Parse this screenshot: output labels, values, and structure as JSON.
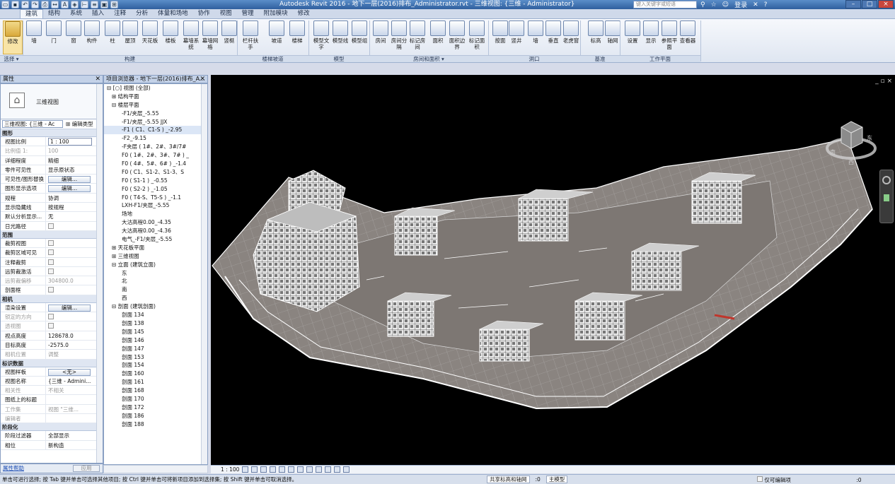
{
  "window": {
    "title": "Autodesk Revit 2016 -   地下一层(2016)排布_Administrator.rvt - 三维视图: {三维 - Administrator}",
    "search_placeholder": "键入关键字或短语",
    "login": "登录"
  },
  "app_button": "R",
  "ribbon_tabs": [
    "建筑",
    "结构",
    "系统",
    "插入",
    "注释",
    "分析",
    "体量和场地",
    "协作",
    "视图",
    "管理",
    "附加模块",
    "修改"
  ],
  "ribbon": {
    "tools": [
      {
        "label": "修改",
        "name": "modify-tool"
      },
      {
        "label": "墙",
        "name": "wall-tool"
      },
      {
        "label": "门",
        "name": "door-tool"
      },
      {
        "label": "窗",
        "name": "window-tool"
      },
      {
        "label": "构件",
        "name": "component-tool"
      },
      {
        "label": "柱",
        "name": "column-tool"
      },
      {
        "label": "屋顶",
        "name": "roof-tool"
      },
      {
        "label": "天花板",
        "name": "ceiling-tool"
      },
      {
        "label": "楼板",
        "name": "floor-tool"
      },
      {
        "label": "幕墙系统",
        "name": "curtain-system-tool"
      },
      {
        "label": "幕墙网格",
        "name": "curtain-grid-tool"
      },
      {
        "label": "竖梃",
        "name": "mullion-tool"
      },
      {
        "label": "栏杆扶手",
        "name": "railing-tool"
      },
      {
        "label": "坡道",
        "name": "ramp-tool"
      },
      {
        "label": "楼梯",
        "name": "stair-tool"
      },
      {
        "label": "模型文字",
        "name": "model-text-tool"
      },
      {
        "label": "模型线",
        "name": "model-line-tool"
      },
      {
        "label": "模型组",
        "name": "model-group-tool"
      },
      {
        "label": "房间",
        "name": "room-tool"
      },
      {
        "label": "房间分隔",
        "name": "room-separator-tool"
      },
      {
        "label": "标记房间",
        "name": "tag-room-tool"
      },
      {
        "label": "面积",
        "name": "area-tool"
      },
      {
        "label": "面积边界",
        "name": "area-boundary-tool"
      },
      {
        "label": "标记面积",
        "name": "tag-area-tool"
      },
      {
        "label": "按面",
        "name": "by-face-tool"
      },
      {
        "label": "竖井",
        "name": "shaft-tool"
      },
      {
        "label": "墙",
        "name": "wall-opening-tool"
      },
      {
        "label": "垂直",
        "name": "vertical-opening-tool"
      },
      {
        "label": "老虎窗",
        "name": "dormer-tool"
      },
      {
        "label": "标高",
        "name": "level-tool"
      },
      {
        "label": "轴网",
        "name": "grid-tool"
      },
      {
        "label": "设置",
        "name": "set-workplane-tool"
      },
      {
        "label": "显示",
        "name": "show-workplane-tool"
      },
      {
        "label": "参照平面",
        "name": "ref-plane-tool"
      },
      {
        "label": "查看器",
        "name": "viewer-tool"
      }
    ],
    "groups": [
      "选择 ▾",
      "构建",
      "楼梯坡道",
      "模型",
      "房间和面积 ▾",
      "洞口",
      "基准",
      "工作平面"
    ]
  },
  "properties": {
    "header": "属性",
    "type_name": "三维视图",
    "type_selector": "三维视图: {三维 - Ac",
    "edit_type": "编辑类型",
    "sections": [
      {
        "title": "图形",
        "rows": [
          {
            "k": "视图比例",
            "v": "1 : 100",
            "kind": "input"
          },
          {
            "k": "比例值 1:",
            "v": "100",
            "kind": "dim"
          },
          {
            "k": "详细程度",
            "v": "精细"
          },
          {
            "k": "零件可见性",
            "v": "显示原状态"
          },
          {
            "k": "可见性/图形替换",
            "v": "编辑...",
            "kind": "button"
          },
          {
            "k": "图形显示选项",
            "v": "编辑...",
            "kind": "button"
          },
          {
            "k": "规程",
            "v": "协调"
          },
          {
            "k": "显示隐藏线",
            "v": "按规程"
          },
          {
            "k": "默认分析显示...",
            "v": "无"
          },
          {
            "k": "日光路径",
            "v": "",
            "kind": "check"
          }
        ]
      },
      {
        "title": "范围",
        "rows": [
          {
            "k": "裁剪视图",
            "v": "",
            "kind": "check"
          },
          {
            "k": "裁剪区域可见",
            "v": "",
            "kind": "check"
          },
          {
            "k": "注释裁剪",
            "v": "",
            "kind": "check"
          },
          {
            "k": "远剪裁激活",
            "v": "",
            "kind": "check"
          },
          {
            "k": "远剪裁偏移",
            "v": "304800.0",
            "kind": "dim"
          },
          {
            "k": "剖面框",
            "v": "",
            "kind": "check"
          }
        ]
      },
      {
        "title": "相机",
        "rows": [
          {
            "k": "渲染设置",
            "v": "编辑...",
            "kind": "button"
          },
          {
            "k": "锁定的方向",
            "v": "",
            "kind": "dimcheck"
          },
          {
            "k": "透视图",
            "v": "",
            "kind": "dimcheck"
          },
          {
            "k": "视点高度",
            "v": "128678.0"
          },
          {
            "k": "目标高度",
            "v": "-2575.0"
          },
          {
            "k": "相机位置",
            "v": "调整",
            "kind": "dim"
          }
        ]
      },
      {
        "title": "标识数据",
        "rows": [
          {
            "k": "视图样板",
            "v": "<无>",
            "kind": "button"
          },
          {
            "k": "视图名称",
            "v": "{三维 - Admini..."
          },
          {
            "k": "相关性",
            "v": "不相关",
            "kind": "dim"
          },
          {
            "k": "图纸上的标题",
            "v": ""
          },
          {
            "k": "工作集",
            "v": "视图 \"三维...",
            "kind": "dim"
          },
          {
            "k": "编辑者",
            "v": "",
            "kind": "dim"
          }
        ]
      },
      {
        "title": "阶段化",
        "rows": [
          {
            "k": "阶段过滤器",
            "v": "全部显示"
          },
          {
            "k": "相位",
            "v": "新构造"
          }
        ]
      }
    ],
    "help_link": "属性帮助",
    "apply": "应用"
  },
  "browser": {
    "header": "项目浏览器 - 地下一层(2016)排布_A...",
    "items": [
      {
        "t": "⊟ [○] 视图 (全部)",
        "d": 0
      },
      {
        "t": "⊞  结构平面",
        "d": 1
      },
      {
        "t": "⊟  楼层平面",
        "d": 1
      },
      {
        "t": "-F1/夹层_-5.55",
        "d": 3
      },
      {
        "t": "-F1/夹层_-5.55 JJX",
        "d": 3
      },
      {
        "t": "-F1 ( C1、C1-S ) _-2.95",
        "d": 3,
        "sel": true
      },
      {
        "t": "-F2_-9.15",
        "d": 3
      },
      {
        "t": "-F夹层 ( 1#、2#、3#/7#",
        "d": 3
      },
      {
        "t": "F0 ( 1#、2#、3#、7# ) _",
        "d": 3
      },
      {
        "t": "F0 ( 4#、5#、6# ) _-1.4",
        "d": 3
      },
      {
        "t": "F0 ( C1、S1-2、S1-3、S",
        "d": 3
      },
      {
        "t": "F0 ( S1-1 ) _-0.55",
        "d": 3
      },
      {
        "t": "F0 ( S2-2 ) _-1.05",
        "d": 3
      },
      {
        "t": "F0 ( T4-S、T5-S ) _-1.1",
        "d": 3
      },
      {
        "t": "LXH-F1/夹层_-5.55",
        "d": 3
      },
      {
        "t": "场地",
        "d": 3
      },
      {
        "t": "大沽高程0.00_-4.35",
        "d": 3
      },
      {
        "t": "大沽高程0.00_-4.36",
        "d": 3
      },
      {
        "t": "电气_-F1/夹层_-5.55",
        "d": 3
      },
      {
        "t": "⊞  天花板平面",
        "d": 1
      },
      {
        "t": "⊞  三维视图",
        "d": 1
      },
      {
        "t": "⊟  立面 (建筑立面)",
        "d": 1
      },
      {
        "t": "东",
        "d": 3
      },
      {
        "t": "北",
        "d": 3
      },
      {
        "t": "南",
        "d": 3
      },
      {
        "t": "西",
        "d": 3
      },
      {
        "t": "⊟  剖面 (建筑剖面)",
        "d": 1
      },
      {
        "t": "剖面 134",
        "d": 3
      },
      {
        "t": "剖面 138",
        "d": 3
      },
      {
        "t": "剖面 145",
        "d": 3
      },
      {
        "t": "剖面 146",
        "d": 3
      },
      {
        "t": "剖面 147",
        "d": 3
      },
      {
        "t": "剖面 153",
        "d": 3
      },
      {
        "t": "剖面 154",
        "d": 3
      },
      {
        "t": "剖面 160",
        "d": 3
      },
      {
        "t": "剖面 161",
        "d": 3
      },
      {
        "t": "剖面 168",
        "d": 3
      },
      {
        "t": "剖面 170",
        "d": 3
      },
      {
        "t": "剖面 172",
        "d": 3
      },
      {
        "t": "剖面 186",
        "d": 3
      },
      {
        "t": "剖面 188",
        "d": 3
      }
    ]
  },
  "viewcube": {
    "face_labels": [
      "南",
      "东",
      "西"
    ]
  },
  "viewbar": {
    "scale": "1 : 100"
  },
  "status": {
    "message": "单击可进行选择; 按 Tab 键并单击可选择其他项目; 按 Ctrl 键并单击可将新项目添加到选择集; 按 Shift 键并单击可取消选择。",
    "workset": "共享标高和轴网",
    "selection_count": ":0",
    "model": "主模型",
    "editable_only": "仅可编辑项",
    "filter_count": ":0"
  },
  "colors": {
    "accent": "#3a6eb5",
    "viewport_bg": "#000000",
    "model_fill": "#8a8480",
    "model_edge": "#ffffff"
  }
}
